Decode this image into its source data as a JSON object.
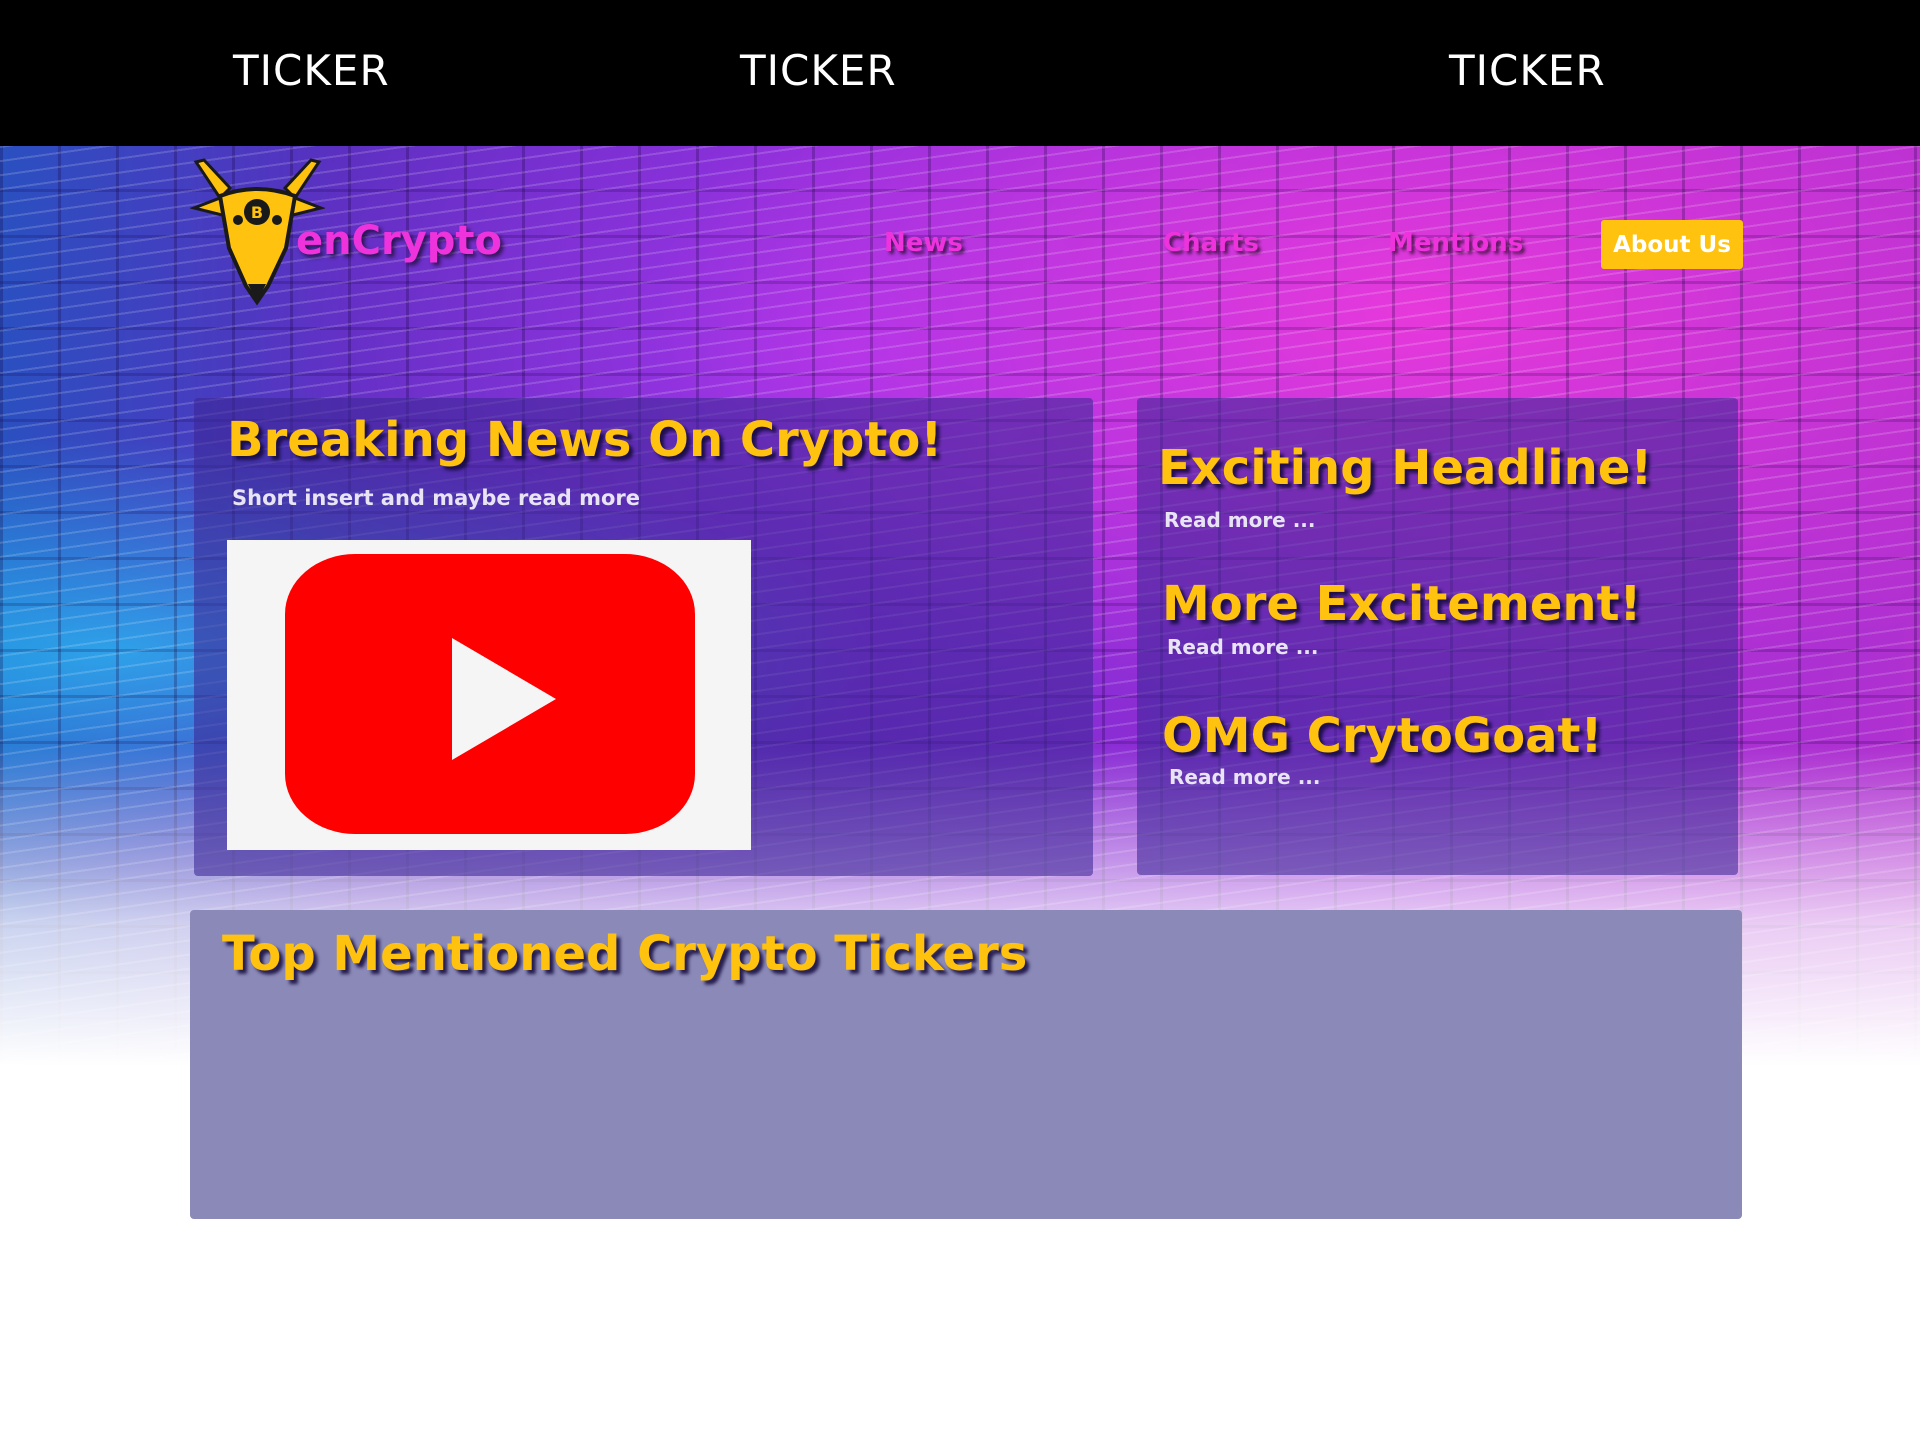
{
  "ticker_bar": {
    "items": [
      "TICKER",
      "TICKER",
      "TICKER"
    ]
  },
  "header": {
    "brand": "enCrypto",
    "logo_icon": "bitcoin-goat-logo",
    "nav": {
      "news": "News",
      "charts": "Charts",
      "mentions": "Mentions",
      "about": "About Us"
    }
  },
  "breaking_news": {
    "title": "Breaking News On Crypto!",
    "subtitle": "Short insert and maybe read more",
    "video_icon": "youtube-play-icon"
  },
  "headlines": [
    {
      "title": "Exciting Headline!",
      "link": "Read more ..."
    },
    {
      "title": "More Excitement!",
      "link": "Read more ..."
    },
    {
      "title": "OMG CrytoGoat!",
      "link": "Read more ..."
    }
  ],
  "tickers_section": {
    "title": "Top Mentioned Crypto Tickers"
  },
  "colors": {
    "accent_gold": "#ffc20e",
    "brand_magenta": "#ee33dd",
    "panel_purple": "#3c2896",
    "ticker_panel": "#8a89b8",
    "youtube_red": "#ff0000"
  }
}
